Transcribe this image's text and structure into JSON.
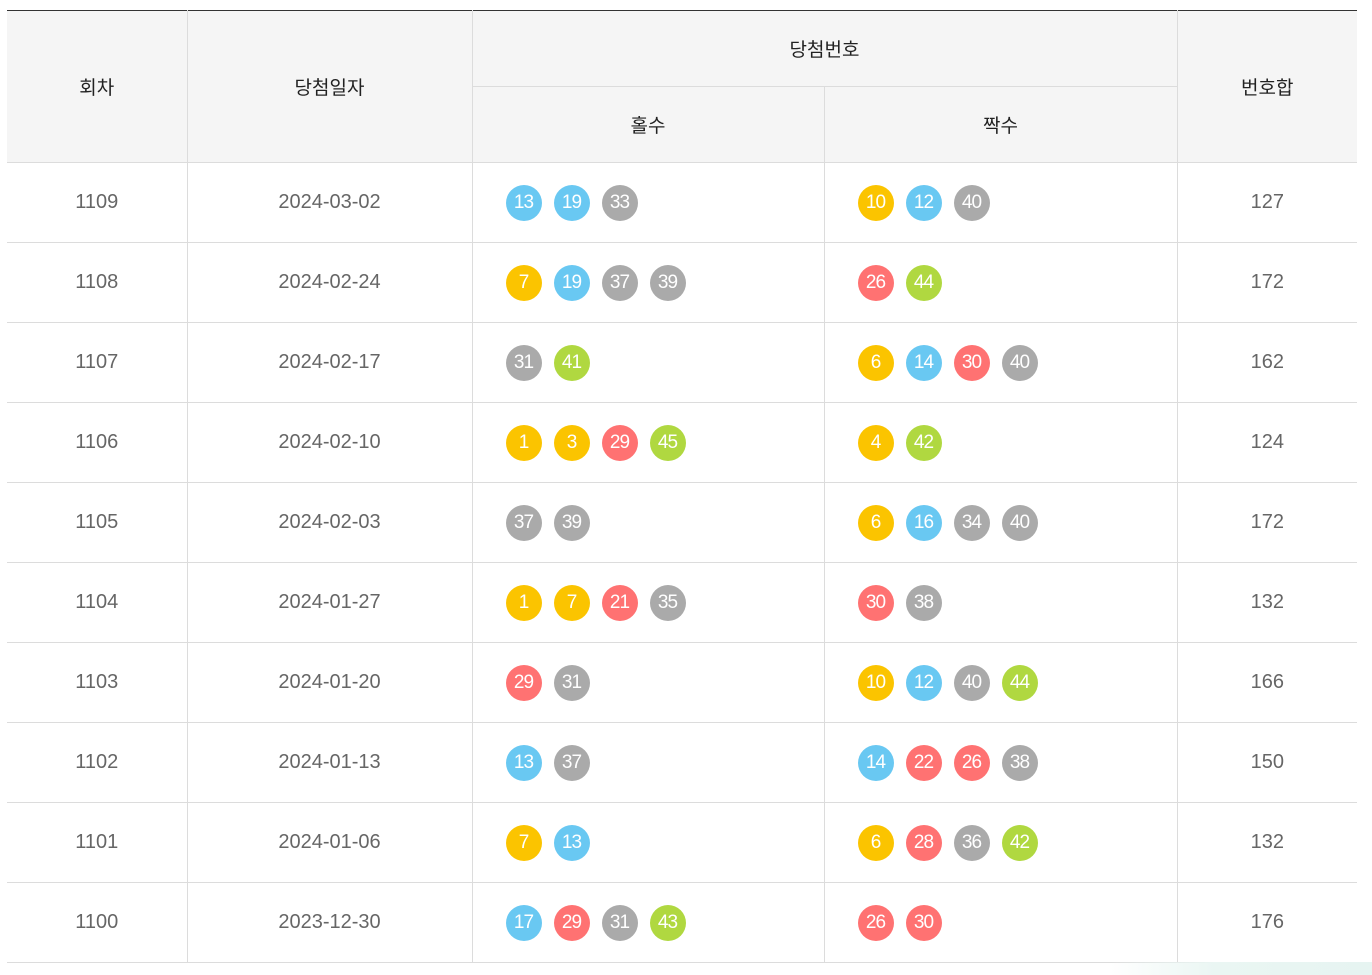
{
  "header": {
    "round": "회차",
    "date": "당첨일자",
    "winning_numbers": "당첨번호",
    "odd": "홀수",
    "even": "짝수",
    "sum": "번호합"
  },
  "ball_colors": {
    "yellow": "#fbc400",
    "blue": "#69c8f2",
    "red": "#ff7272",
    "gray": "#aaaaaa",
    "green": "#b0d840"
  },
  "rows": [
    {
      "round": "1109",
      "date": "2024-03-02",
      "odd": [
        13,
        19,
        33
      ],
      "even": [
        10,
        12,
        40
      ],
      "sum": "127"
    },
    {
      "round": "1108",
      "date": "2024-02-24",
      "odd": [
        7,
        19,
        37,
        39
      ],
      "even": [
        26,
        44
      ],
      "sum": "172"
    },
    {
      "round": "1107",
      "date": "2024-02-17",
      "odd": [
        31,
        41
      ],
      "even": [
        6,
        14,
        30,
        40
      ],
      "sum": "162"
    },
    {
      "round": "1106",
      "date": "2024-02-10",
      "odd": [
        1,
        3,
        29,
        45
      ],
      "even": [
        4,
        42
      ],
      "sum": "124"
    },
    {
      "round": "1105",
      "date": "2024-02-03",
      "odd": [
        37,
        39
      ],
      "even": [
        6,
        16,
        34,
        40
      ],
      "sum": "172"
    },
    {
      "round": "1104",
      "date": "2024-01-27",
      "odd": [
        1,
        7,
        21,
        35
      ],
      "even": [
        30,
        38
      ],
      "sum": "132"
    },
    {
      "round": "1103",
      "date": "2024-01-20",
      "odd": [
        29,
        31
      ],
      "even": [
        10,
        12,
        40,
        44
      ],
      "sum": "166"
    },
    {
      "round": "1102",
      "date": "2024-01-13",
      "odd": [
        13,
        37
      ],
      "even": [
        14,
        22,
        26,
        38
      ],
      "sum": "150"
    },
    {
      "round": "1101",
      "date": "2024-01-06",
      "odd": [
        7,
        13
      ],
      "even": [
        6,
        28,
        36,
        42
      ],
      "sum": "132"
    },
    {
      "round": "1100",
      "date": "2023-12-30",
      "odd": [
        17,
        29,
        31,
        43
      ],
      "even": [
        26,
        30
      ],
      "sum": "176"
    }
  ]
}
